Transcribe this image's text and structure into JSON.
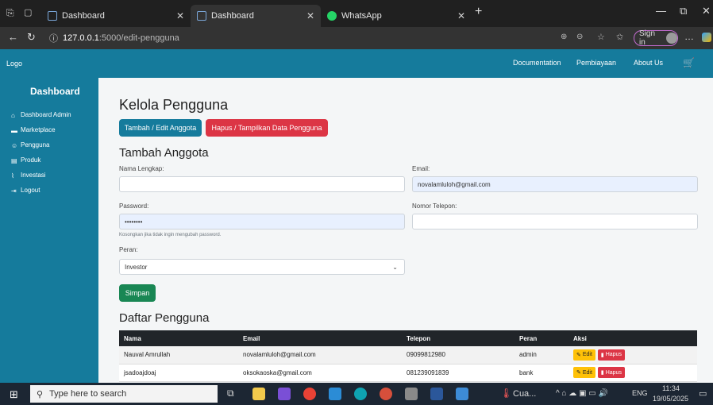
{
  "browser": {
    "tabs": [
      {
        "title": "Dashboard"
      },
      {
        "title": "Dashboard"
      },
      {
        "title": "WhatsApp"
      }
    ],
    "url_host": "127.0.0.1",
    "url_path": ":5000/edit-pengguna",
    "sign_in": "Sign in"
  },
  "navbar": {
    "logo": "Logo",
    "links": [
      "Documentation",
      "Pembiayaan",
      "About Us"
    ]
  },
  "sidebar": {
    "title": "Dashboard",
    "items": [
      {
        "label": "Dashboard Admin",
        "icon": "home-icon"
      },
      {
        "label": "Marketplace",
        "icon": "store-icon"
      },
      {
        "label": "Pengguna",
        "icon": "users-icon"
      },
      {
        "label": "Produk",
        "icon": "box-icon"
      },
      {
        "label": "Investasi",
        "icon": "chart-icon"
      },
      {
        "label": "Logout",
        "icon": "logout-icon"
      }
    ]
  },
  "main": {
    "title": "Kelola Pengguna",
    "btn_add_edit": "Tambah / Edit Anggota",
    "btn_delete_show": "Hapus / Tampilkan Data Pengguna",
    "form_title": "Tambah Anggota",
    "label_name": "Nama Lengkap:",
    "label_email": "Email:",
    "value_email": "novalamluloh@gmail.com",
    "label_password": "Password:",
    "value_password": "••••••••",
    "label_phone": "Nomor Telepon:",
    "hint_password": "Kosongkan jika tidak ingin mengubah password.",
    "label_role": "Peran:",
    "value_role": "Investor",
    "btn_save": "Simpan",
    "list_title": "Daftar Pengguna",
    "table": {
      "headers": [
        "Nama",
        "Email",
        "Telepon",
        "Peran",
        "Aksi"
      ],
      "rows": [
        [
          "Nauval Amrullah",
          "novalamluloh@gmail.com",
          "09099812980",
          "admin"
        ],
        [
          "jsadoajdoaj",
          "oksokaoska@gmail.com",
          "081239091839",
          "bank"
        ]
      ],
      "edit_label": "Edit",
      "delete_label": "Hapus"
    }
  },
  "taskbar": {
    "search_placeholder": "Type here to search",
    "app_label": "Cua...",
    "lang": "ENG",
    "time": "11:34",
    "date": "19/05/2025"
  },
  "colors": {
    "primary": "#157b9c",
    "danger": "#dc3545",
    "success": "#198754",
    "warning": "#ffc107"
  }
}
